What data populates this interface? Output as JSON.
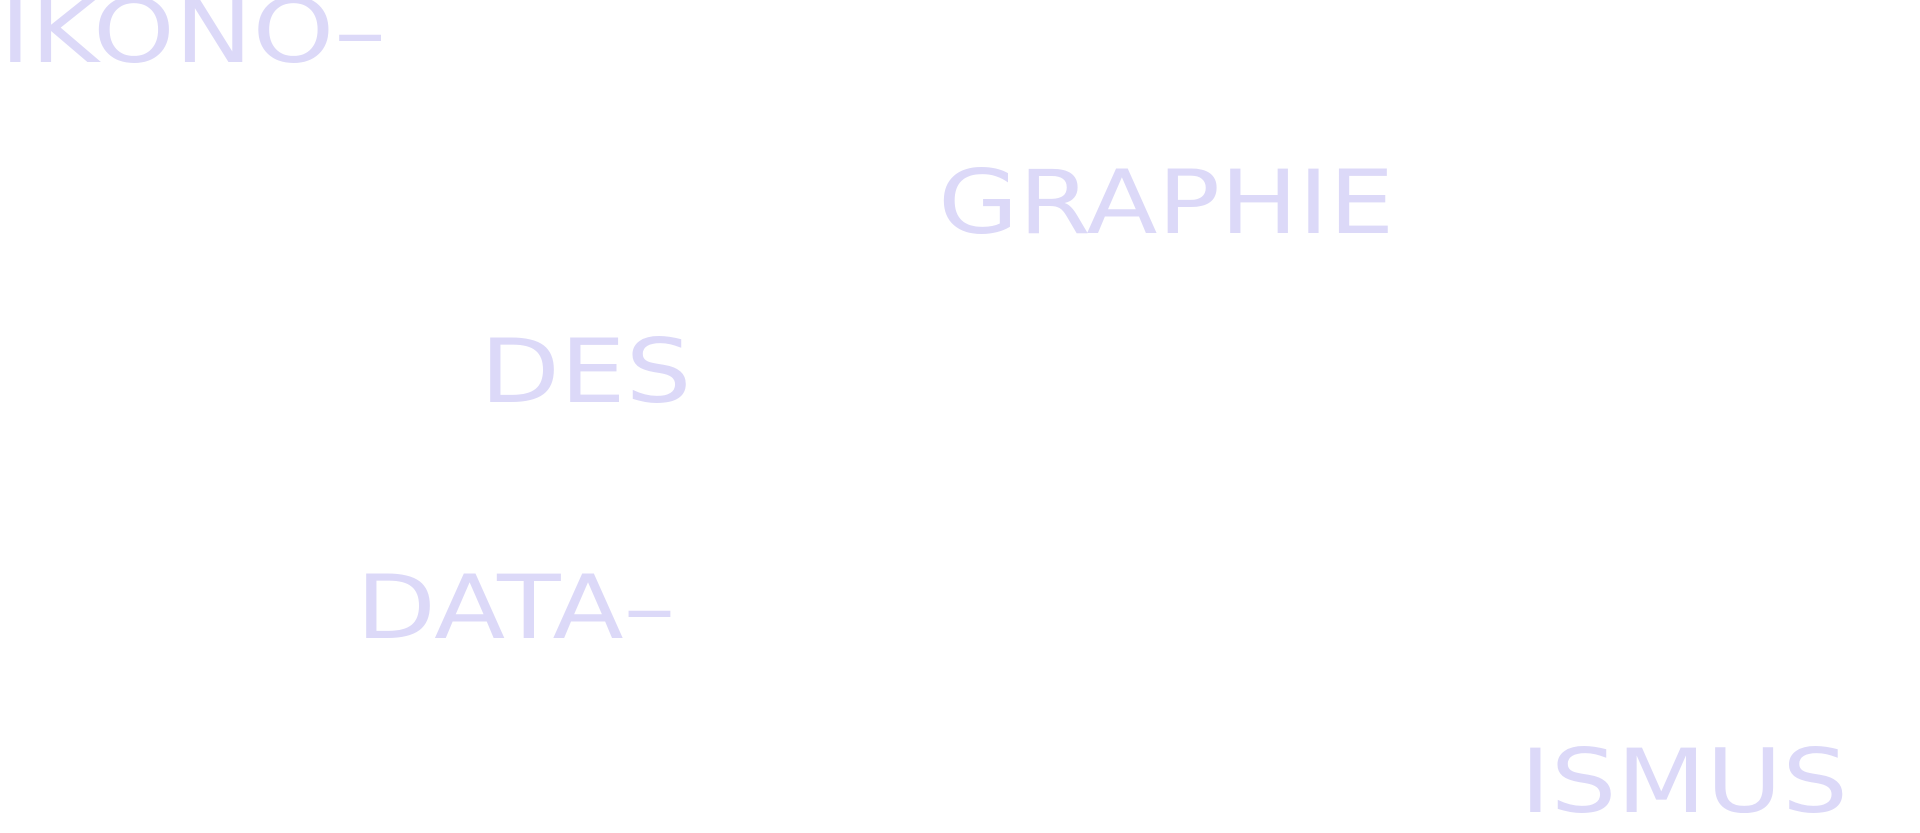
{
  "title_lines": [
    "IKONO–",
    "GRAPHIE",
    "DES",
    "DATA–",
    "ISMUS"
  ],
  "colors": {
    "text": "#dcd9f8",
    "background": "#ffffff"
  }
}
